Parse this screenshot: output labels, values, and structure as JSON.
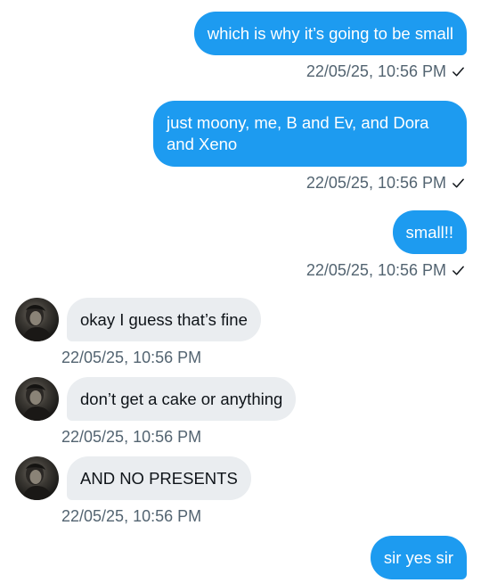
{
  "colors": {
    "outgoing_bubble": "#1d9bf0",
    "incoming_bubble": "#eaedf0",
    "timestamp": "#536471"
  },
  "messages": [
    {
      "direction": "out",
      "text": "which is why it’s going to be small",
      "timestamp": "22/05/25, 10:56 PM",
      "status_icon": "check-icon"
    },
    {
      "direction": "out",
      "text": "just moony, me, B and Ev, and Dora\nand Xeno",
      "timestamp": "22/05/25, 10:56 PM",
      "status_icon": "check-icon"
    },
    {
      "direction": "out",
      "text": "small!!",
      "timestamp": "22/05/25, 10:56 PM",
      "status_icon": "check-icon"
    },
    {
      "direction": "in",
      "text": "okay I guess that’s fine",
      "timestamp": "22/05/25, 10:56 PM",
      "avatar_icon": "avatar"
    },
    {
      "direction": "in",
      "text": "don’t get a cake or anything",
      "timestamp": "22/05/25, 10:56 PM",
      "avatar_icon": "avatar"
    },
    {
      "direction": "in",
      "text": "AND NO PRESENTS",
      "timestamp": "22/05/25, 10:56 PM",
      "avatar_icon": "avatar"
    },
    {
      "direction": "out",
      "text": "sir yes sir",
      "timestamp": "",
      "status_icon": ""
    }
  ]
}
